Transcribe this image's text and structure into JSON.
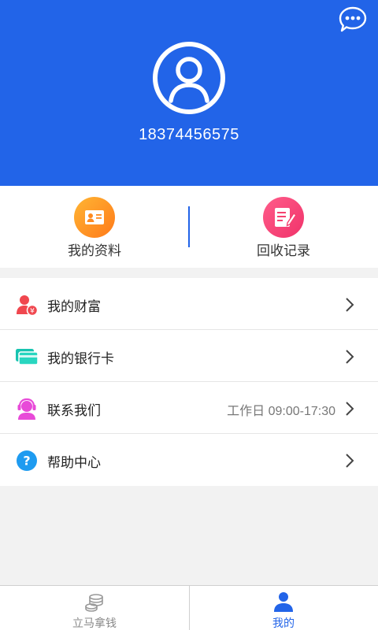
{
  "header": {
    "phone": "18374456575"
  },
  "quick_actions": [
    {
      "label": "我的资料",
      "icon": "profile-card-icon",
      "color": "#ff8a1f"
    },
    {
      "label": "回收记录",
      "icon": "edit-note-icon",
      "color": "#f5416f"
    }
  ],
  "menu": [
    {
      "label": "我的财富",
      "icon": "user-wealth-icon",
      "extra": ""
    },
    {
      "label": "我的银行卡",
      "icon": "bank-card-icon",
      "extra": ""
    },
    {
      "label": "联系我们",
      "icon": "headset-icon",
      "extra": "工作日 09:00-17:30"
    },
    {
      "label": "帮助中心",
      "icon": "help-icon",
      "extra": ""
    }
  ],
  "tabbar": [
    {
      "label": "立马拿钱",
      "icon": "coins-icon",
      "active": false
    },
    {
      "label": "我的",
      "icon": "person-icon",
      "active": true
    }
  ],
  "colors": {
    "brand": "#2264e8",
    "inactive_tab": "#888888"
  }
}
